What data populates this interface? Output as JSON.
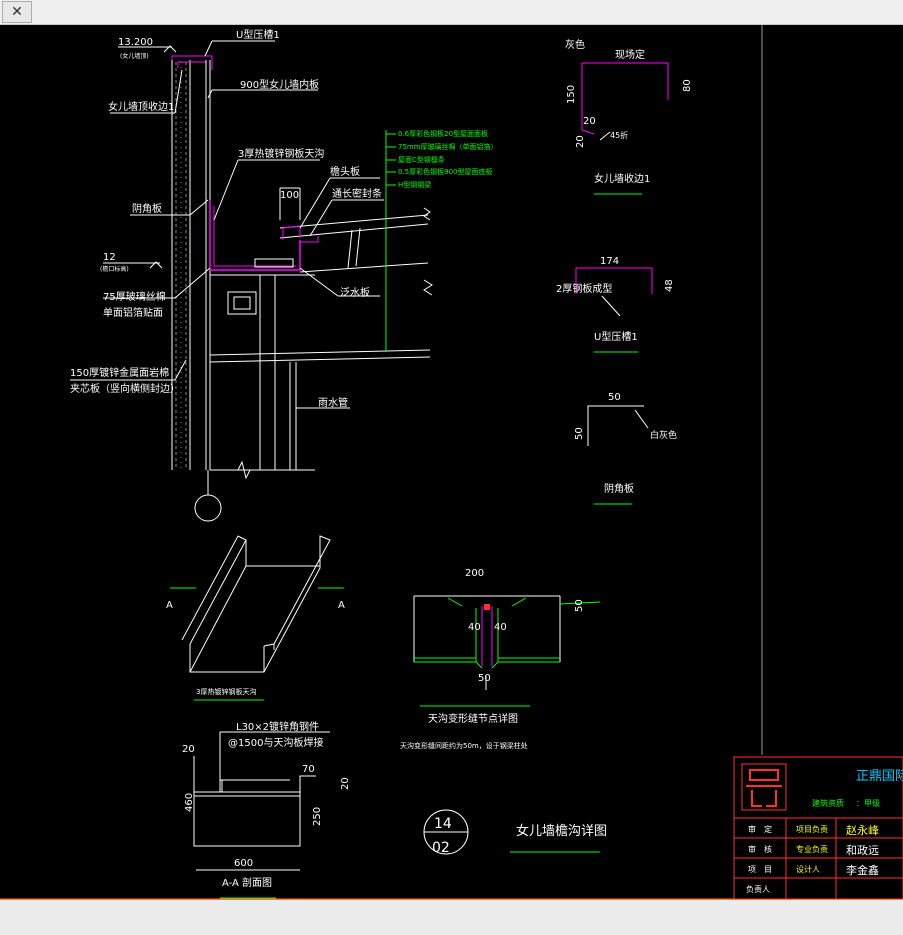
{
  "window": {
    "close_icon": "✕"
  },
  "drawing": {
    "top_elev": "13.200",
    "top_elev_sub": "(女儿墙顶)",
    "u_cap": "U型压槽1",
    "inner_panel": "900型女儿墙内板",
    "parapet_cap": "女儿墙顶收边1",
    "gutter": "3厚热镀锌钢板天沟",
    "flashing": "阴角板",
    "elev_gutter": "12",
    "elev_gutter_sub": "(檐口标高)",
    "glass_wool_1": "75厚玻璃丝棉",
    "glass_wool_2": "单面铝箔贴面",
    "sandwich_1": "150厚镀锌金属面岩棉",
    "sandwich_2": "夹芯板（竖向横侧封边）",
    "roof_notes": [
      "0.6厚彩色钢板20型屋面面板",
      "75mm厚玻璃丝棉（单面铝箔）",
      "屋面C型钢檩条",
      "0.5厚彩色钢板900型屋面底板",
      "H型钢钢梁"
    ],
    "eave_board": "檐头板",
    "dim_100": "100",
    "seal_strip": "通长密封条",
    "drain_board": "泛水板",
    "downpipe": "雨水管",
    "pf_label_grey": "灰色",
    "pf_label_span": "现场定",
    "pf_dim_150": "150",
    "pf_dim_80": "80",
    "pf_dim_20a": "20",
    "pf_dim_20b": "20",
    "pf_label_fold": "45折",
    "pf_title": "女儿墙收边1",
    "u_dim_174": "174",
    "u_dim_48": "48",
    "u_label_mat": "2厚钢板成型",
    "u_title": "U型压槽1",
    "fl_dim_50a": "50",
    "fl_dim_50b": "50",
    "fl_label_white": "白灰色",
    "fl_title": "阴角板",
    "iso_a_left": "A",
    "iso_a_right": "A",
    "iso_title": "3厚热镀锌钢板天沟",
    "jt_dim_200": "200",
    "jt_dim_40a": "40",
    "jt_dim_40b": "40",
    "jt_dim_50": "50",
    "jt_dim_50r": "50",
    "jt_title": "天沟变形缝节点详图",
    "jt_note": "天沟变形缝间距约为50m，设于钢梁柱处",
    "sec_note_1": "L30×2镀锌角钢件",
    "sec_note_2": "@1500与天沟板焊接",
    "sec_dim_20": "20",
    "sec_dim_70": "70",
    "sec_dim_20r": "20",
    "sec_dim_460": "460",
    "sec_dim_250": "250",
    "sec_dim_600": "600",
    "sec_title": "A-A 剖面图",
    "detail_no": "14",
    "sheet_no": "02",
    "main_title": "女儿墙檐沟详图"
  },
  "title_block": {
    "company": "正鼎国际",
    "cert_label": "建筑资质",
    "cert_value": "：甲级",
    "rows": [
      {
        "role": "审　定",
        "field": "项目负责",
        "sign": "赵永峰"
      },
      {
        "role": "审　核",
        "field": "专业负责",
        "sign": "和政远"
      },
      {
        "role": "项　目",
        "field": "设计人",
        "sign": "李金鑫"
      },
      {
        "role": "负责人",
        "field": "",
        "sign": ""
      }
    ]
  }
}
